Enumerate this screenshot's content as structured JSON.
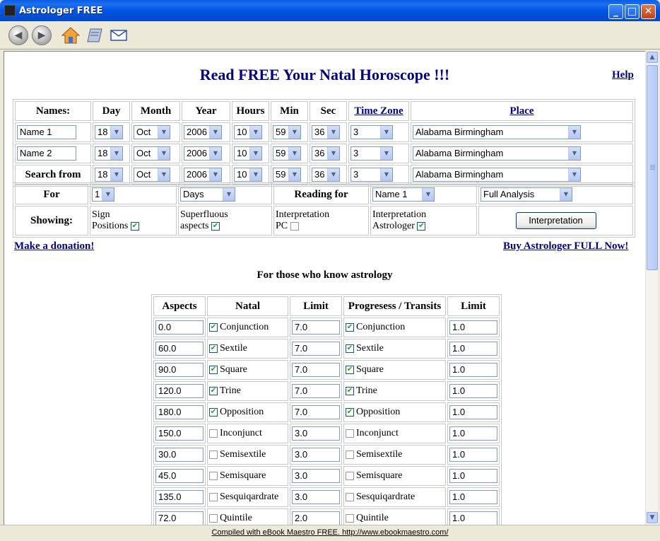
{
  "window": {
    "title": "Astrologer FREE",
    "minimize": "_",
    "maximize": "□",
    "close": "✕"
  },
  "toolbar": {
    "back": "◀",
    "forward": "▶"
  },
  "page": {
    "heading": "Read FREE Your Natal Horoscope !!!",
    "help": "Help"
  },
  "headers": {
    "names": "Names:",
    "day": "Day",
    "month": "Month",
    "year": "Year",
    "hours": "Hours",
    "min": "Min",
    "sec": "Sec",
    "timezone": "Time Zone",
    "place": "Place"
  },
  "rows": [
    {
      "label": "",
      "name": "Name 1",
      "day": "18",
      "month": "Oct",
      "year": "2006",
      "hours": "10",
      "min": "59",
      "sec": "36",
      "tz": "3",
      "place": "Alabama Birmingham"
    },
    {
      "label": "",
      "name": "Name 2",
      "day": "18",
      "month": "Oct",
      "year": "2006",
      "hours": "10",
      "min": "59",
      "sec": "36",
      "tz": "3",
      "place": "Alabama Birmingham"
    },
    {
      "label": "Search from",
      "name": "",
      "day": "18",
      "month": "Oct",
      "year": "2006",
      "hours": "10",
      "min": "59",
      "sec": "36",
      "tz": "3",
      "place": "Alabama Birmingham"
    }
  ],
  "options": {
    "for_label": "For",
    "for_value": "1",
    "period": "Days",
    "reading_label": "Reading for",
    "reading_value": "Name 1",
    "analysis": "Full Analysis",
    "showing_label": "Showing:",
    "sign_line1": "Sign",
    "sign_line2": "Positions",
    "sign_checked": true,
    "superfluous_line1": "Superfluous",
    "superfluous_line2": "aspects",
    "superfluous_checked": true,
    "interp_pc_line1": "Interpretation",
    "interp_pc_line2": "PC",
    "interp_pc_checked": false,
    "interp_astro_line1": "Interpretation",
    "interp_astro_line2": "Astrologer",
    "interp_astro_checked": true,
    "button": "Interpretation"
  },
  "links": {
    "donate": "Make a donation!",
    "buy": "Buy Astrologer FULL Now!"
  },
  "aspects_section": {
    "title": "For those who know astrology",
    "headers": {
      "aspects": "Aspects",
      "natal": "Natal",
      "limit": "Limit",
      "progress": "Progresess / Transits",
      "limit2": "Limit"
    },
    "rows": [
      {
        "deg": "0.0",
        "name": "Conjunction",
        "natal": true,
        "limit": "7.0",
        "trans": true,
        "limit2": "1.0"
      },
      {
        "deg": "60.0",
        "name": "Sextile",
        "natal": true,
        "limit": "7.0",
        "trans": true,
        "limit2": "1.0"
      },
      {
        "deg": "90.0",
        "name": "Square",
        "natal": true,
        "limit": "7.0",
        "trans": true,
        "limit2": "1.0"
      },
      {
        "deg": "120.0",
        "name": "Trine",
        "natal": true,
        "limit": "7.0",
        "trans": true,
        "limit2": "1.0"
      },
      {
        "deg": "180.0",
        "name": "Opposition",
        "natal": true,
        "limit": "7.0",
        "trans": true,
        "limit2": "1.0"
      },
      {
        "deg": "150.0",
        "name": "Inconjunct",
        "natal": false,
        "limit": "3.0",
        "trans": false,
        "limit2": "1.0"
      },
      {
        "deg": "30.0",
        "name": "Semisextile",
        "natal": false,
        "limit": "3.0",
        "trans": false,
        "limit2": "1.0"
      },
      {
        "deg": "45.0",
        "name": "Semisquare",
        "natal": false,
        "limit": "3.0",
        "trans": false,
        "limit2": "1.0"
      },
      {
        "deg": "135.0",
        "name": "Sesquiqardrate",
        "natal": false,
        "limit": "3.0",
        "trans": false,
        "limit2": "1.0"
      },
      {
        "deg": "72.0",
        "name": "Quintile",
        "natal": false,
        "limit": "2.0",
        "trans": false,
        "limit2": "1.0"
      }
    ]
  },
  "status": {
    "text": "Compiled with eBook Maestro FREE. http://www.ebookmaestro.com/"
  },
  "colors": {
    "title_bar": "#0054E3",
    "link": "#000080",
    "heading": "#000080",
    "chrome": "#ECE9D8"
  }
}
